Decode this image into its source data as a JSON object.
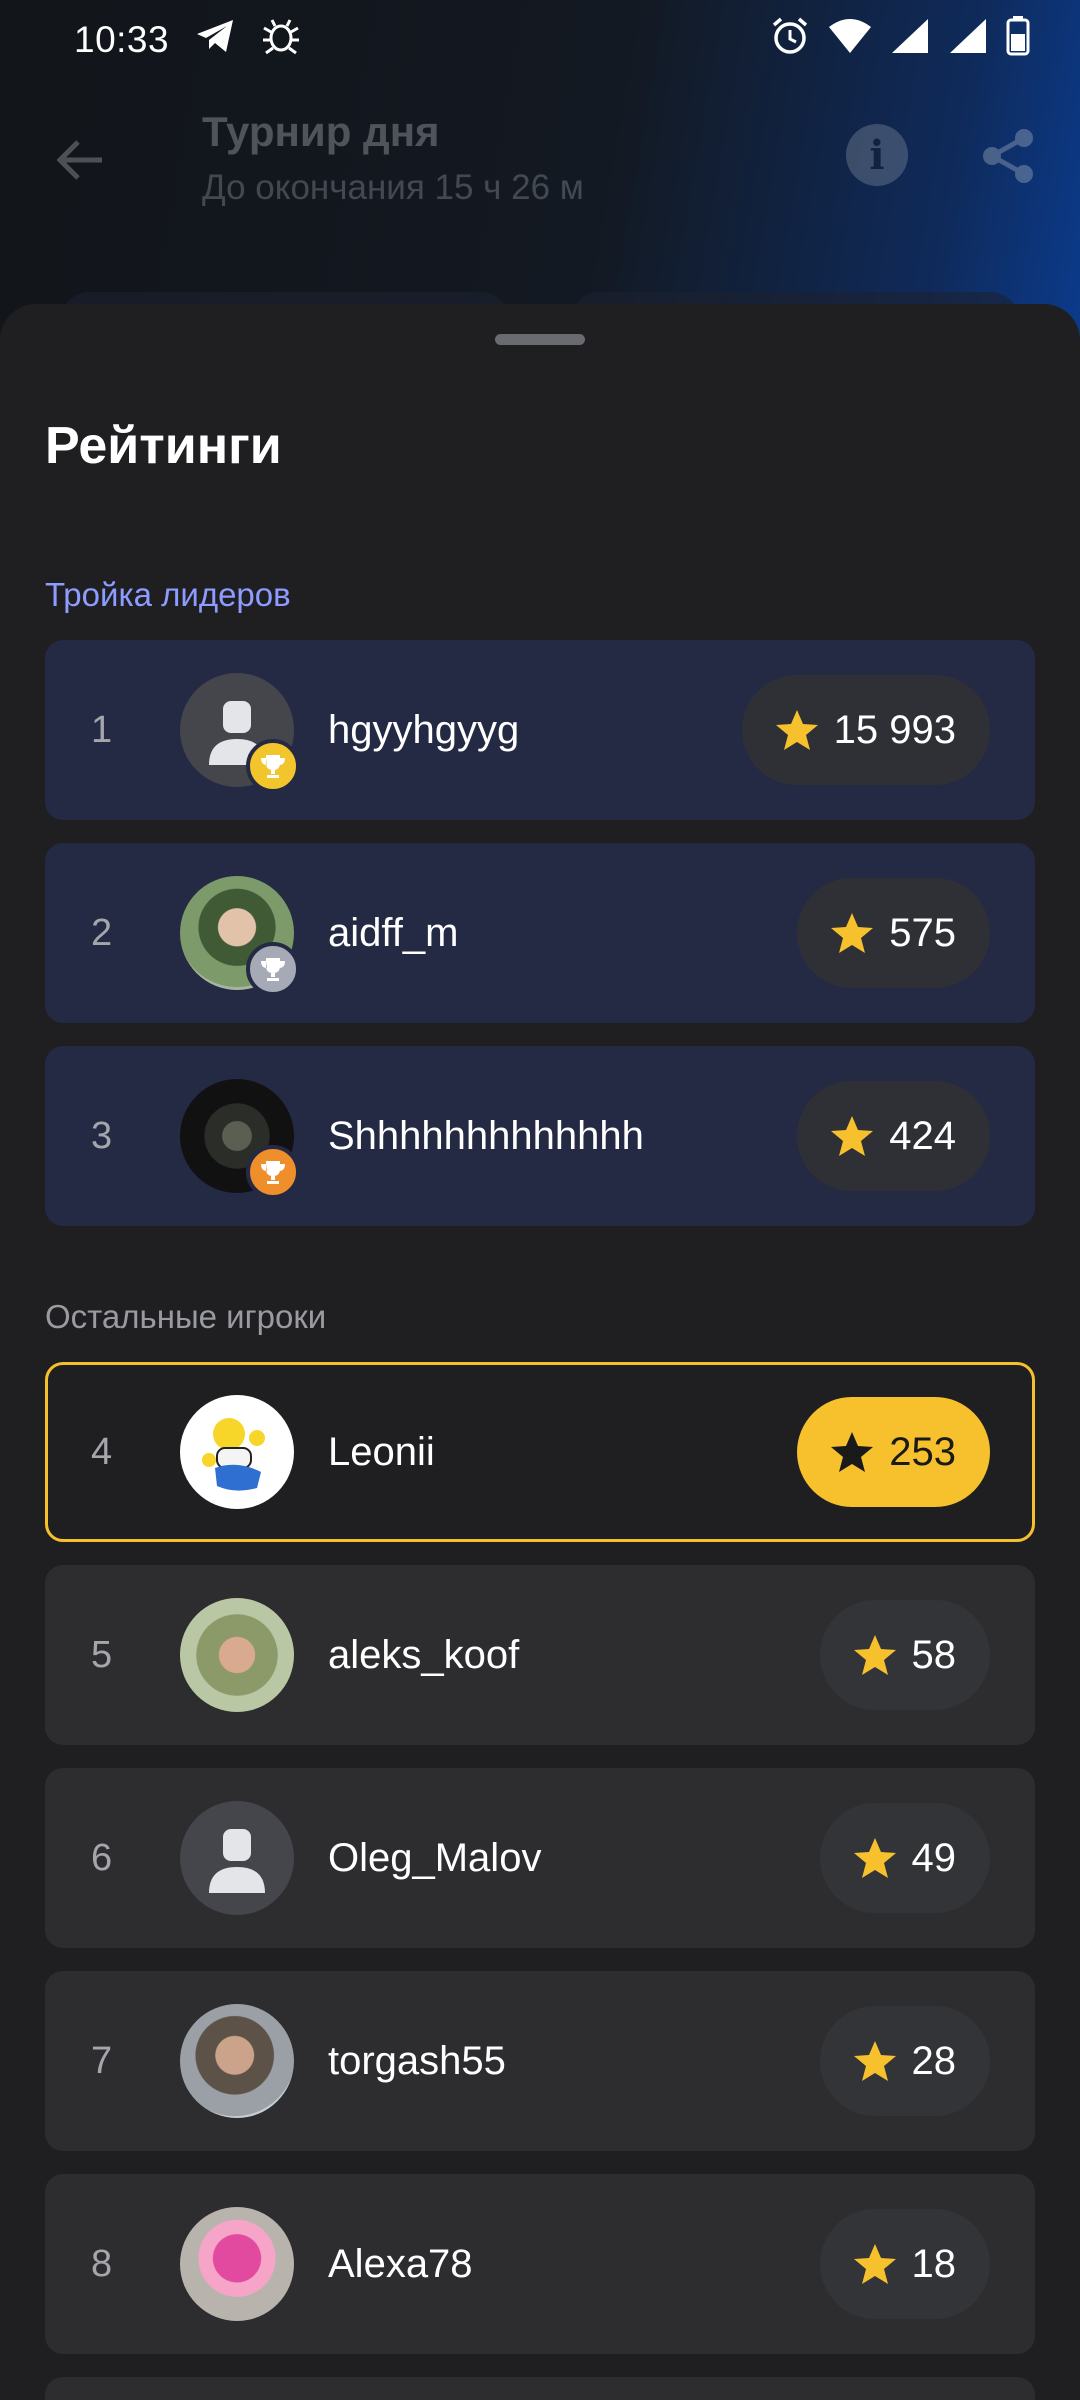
{
  "status_bar": {
    "time": "10:33"
  },
  "app_bar": {
    "title": "Турнир дня",
    "subtitle": "До окончания 15 ч 26 м"
  },
  "sheet": {
    "title": "Рейтинги",
    "leaders_label": "Тройка лидеров",
    "others_label": "Остальные игроки"
  },
  "colors": {
    "accent_yellow": "#f6c12c",
    "leader_row": "#252a44",
    "other_row": "#2d2d30",
    "section_blue": "#8e9bff"
  },
  "leaders": [
    {
      "rank": "1",
      "name": "hgyyhgyyg",
      "score": "15 993",
      "trophy": "gold-trophy-icon",
      "avatar": "placeholder"
    },
    {
      "rank": "2",
      "name": "aidff_m",
      "score": "575",
      "trophy": "silver-trophy-icon",
      "avatar": "photo"
    },
    {
      "rank": "3",
      "name": "Shhhhhhhhhhhhh",
      "score": "424",
      "trophy": "bronze-trophy-icon",
      "avatar": "photo"
    }
  ],
  "others": [
    {
      "rank": "4",
      "name": "Leonii",
      "score": "253",
      "current_user": true,
      "avatar": "photo"
    },
    {
      "rank": "5",
      "name": "aleks_koof",
      "score": "58",
      "avatar": "photo"
    },
    {
      "rank": "6",
      "name": "Oleg_Malov",
      "score": "49",
      "avatar": "placeholder"
    },
    {
      "rank": "7",
      "name": "torgash55",
      "score": "28",
      "avatar": "photo"
    },
    {
      "rank": "8",
      "name": "Alexa78",
      "score": "18",
      "avatar": "photo"
    }
  ]
}
